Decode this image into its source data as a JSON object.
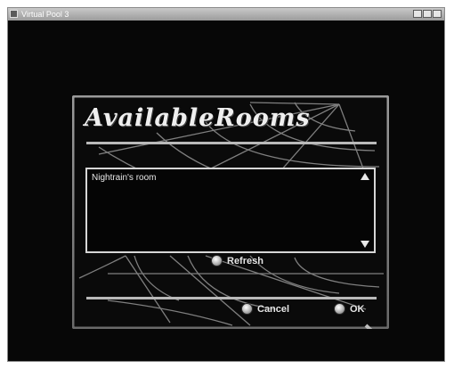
{
  "window": {
    "title": "Virtual Pool 3"
  },
  "dialog": {
    "title": "AvailableRooms",
    "rooms": [
      "Nightrain's room"
    ],
    "buttons": {
      "refresh": "Refresh",
      "cancel": "Cancel",
      "ok": "OK"
    }
  }
}
